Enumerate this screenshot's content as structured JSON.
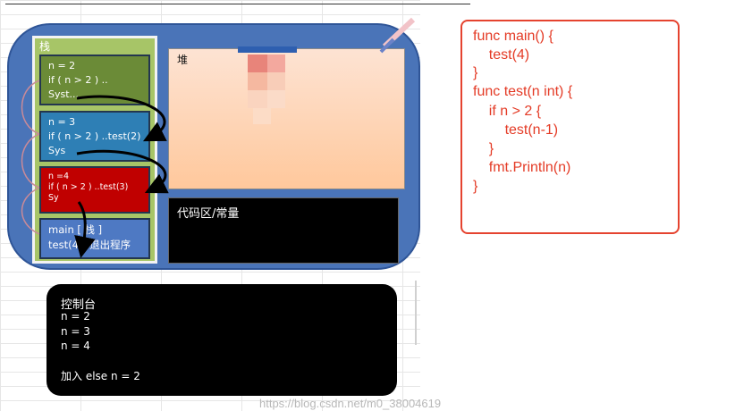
{
  "memory": {
    "stack_title": "栈",
    "frames": [
      {
        "lines": [
          "n = 2",
          "if ( n > 2 ) ..",
          "Syst..."
        ]
      },
      {
        "lines": [
          "n  = 3",
          "if ( n > 2 ) ..test(2)",
          "Sys"
        ]
      },
      {
        "lines": [
          "n =4",
          "if ( n > 2 ) ..test(3)",
          "Sy"
        ]
      },
      {
        "lines": [
          "main [ 栈 ]",
          "test(4)//退出程序"
        ]
      }
    ],
    "heap_label": "堆",
    "code_area_label": "代码区/常量"
  },
  "console": {
    "lines": [
      "控制台",
      "n = 2",
      "n = 3",
      "n = 4",
      "",
      "加入 else  n = 2"
    ]
  },
  "code": {
    "lines": [
      "func main() {",
      "    test(4)",
      "}",
      "func test(n int) {",
      "    if n > 2 {",
      "        test(n-1)",
      "    }",
      "    fmt.Println(n)",
      "}"
    ]
  },
  "watermark": "https://blog.csdn.net/m0_38004619",
  "colors": {
    "oval": "#4a74b8",
    "stack_panel": "#a7c567",
    "frame1": "#6b8b37",
    "frame2": "#2e7fb5",
    "frame3": "#c00000",
    "frame4": "#4e79c3",
    "code_text": "#e43b26"
  }
}
